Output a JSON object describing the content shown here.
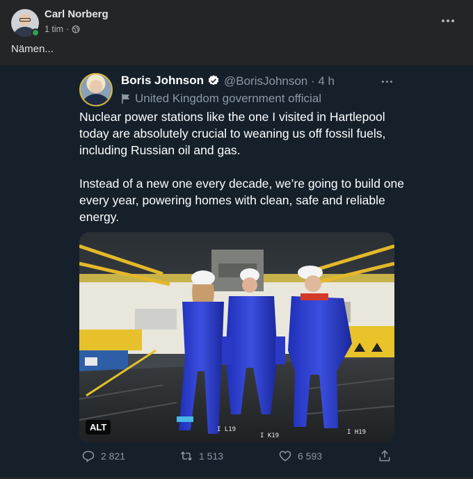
{
  "post": {
    "author": "Carl Norberg",
    "time": "1 tim",
    "separator": "·",
    "text": "Nämen...",
    "privacy_icon": "globe-icon",
    "online": true
  },
  "tweet": {
    "name": "Boris Johnson",
    "handle_time": "@BorisJohnson · 4 h",
    "label": "United Kingdom government official",
    "verified": true,
    "text_p1": "Nuclear power stations like the one I visited in Hartlepool today are absolutely crucial to weaning us off fossil fuels, including Russian oil and gas.",
    "text_p2": "Instead of a new one every decade, we’re going to build one every year, powering homes with clean, safe and reliable energy.",
    "alt_badge": "ALT",
    "replies": "2 821",
    "retweets": "1 513",
    "likes": "6 593"
  },
  "colors": {
    "facebook_bg": "#242526",
    "twitter_bg": "#15202b",
    "accent_blue": "#1d9bf0",
    "muted": "#8b98a5"
  }
}
